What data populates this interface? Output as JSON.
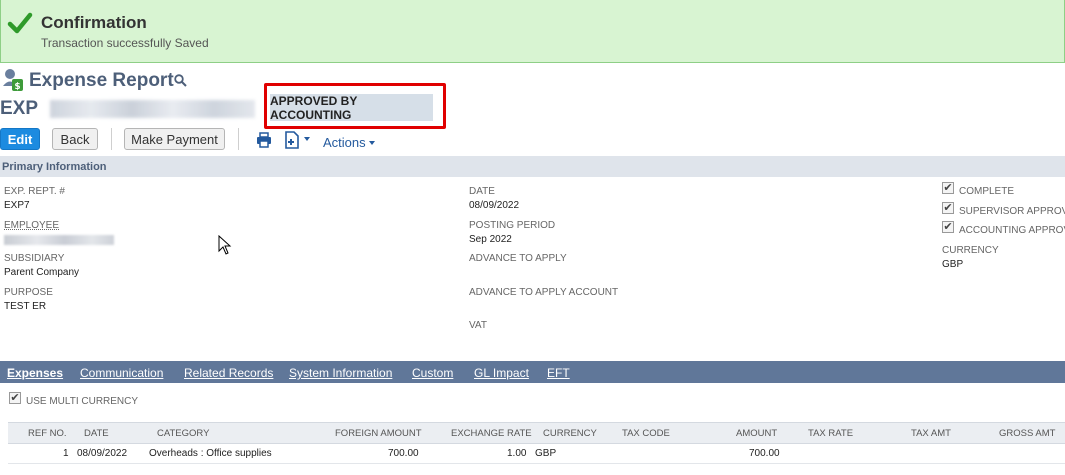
{
  "banner": {
    "title": "Confirmation",
    "message": "Transaction successfully Saved"
  },
  "record": {
    "type_title": "Expense Report",
    "number": "EXP",
    "status": "APPROVED BY ACCOUNTING"
  },
  "toolbar": {
    "edit_label": "Edit",
    "back_label": "Back",
    "make_payment_label": "Make Payment",
    "actions_label": "Actions"
  },
  "primary": {
    "section_title": "Primary Information",
    "exp_rept_label": "EXP. REPT. #",
    "exp_rept_value": "EXP7",
    "employee_label": "EMPLOYEE",
    "subsidiary_label": "SUBSIDIARY",
    "subsidiary_value": "Parent Company",
    "purpose_label": "PURPOSE",
    "purpose_value": "TEST ER",
    "date_label": "DATE",
    "date_value": "08/09/2022",
    "posting_period_label": "POSTING PERIOD",
    "posting_period_value": "Sep 2022",
    "advance_label": "ADVANCE TO APPLY",
    "advance_account_label": "ADVANCE TO APPLY ACCOUNT",
    "vat_label": "VAT",
    "complete_label": "COMPLETE",
    "supervisor_label": "SUPERVISOR APPROVAL",
    "accounting_label": "ACCOUNTING APPROVAL",
    "currency_label": "CURRENCY",
    "currency_value": "GBP"
  },
  "subtabs": [
    "Expenses",
    "Communication",
    "Related Records",
    "System Information",
    "Custom",
    "GL Impact",
    "EFT"
  ],
  "expenses": {
    "multi_currency_label": "USE MULTI CURRENCY",
    "columns": [
      "REF NO.",
      "DATE",
      "CATEGORY",
      "FOREIGN AMOUNT",
      "EXCHANGE RATE",
      "CURRENCY",
      "TAX CODE",
      "AMOUNT",
      "TAX RATE",
      "TAX AMT",
      "GROSS AMT"
    ],
    "rows": [
      {
        "ref_no": "1",
        "date": "08/09/2022",
        "category": "Overheads : Office supplies",
        "foreign_amount": "700.00",
        "exchange_rate": "1.00",
        "currency": "GBP",
        "tax_code": "",
        "amount": "700.00",
        "tax_rate": "",
        "tax_amt": "",
        "gross_amt": ""
      }
    ]
  },
  "colors": {
    "banner_bg": "#d8f4d2",
    "accent_blue": "#1c8be0",
    "header_text": "#4d5f79",
    "subtab_bar": "#607799",
    "highlight_red": "#e00000"
  }
}
